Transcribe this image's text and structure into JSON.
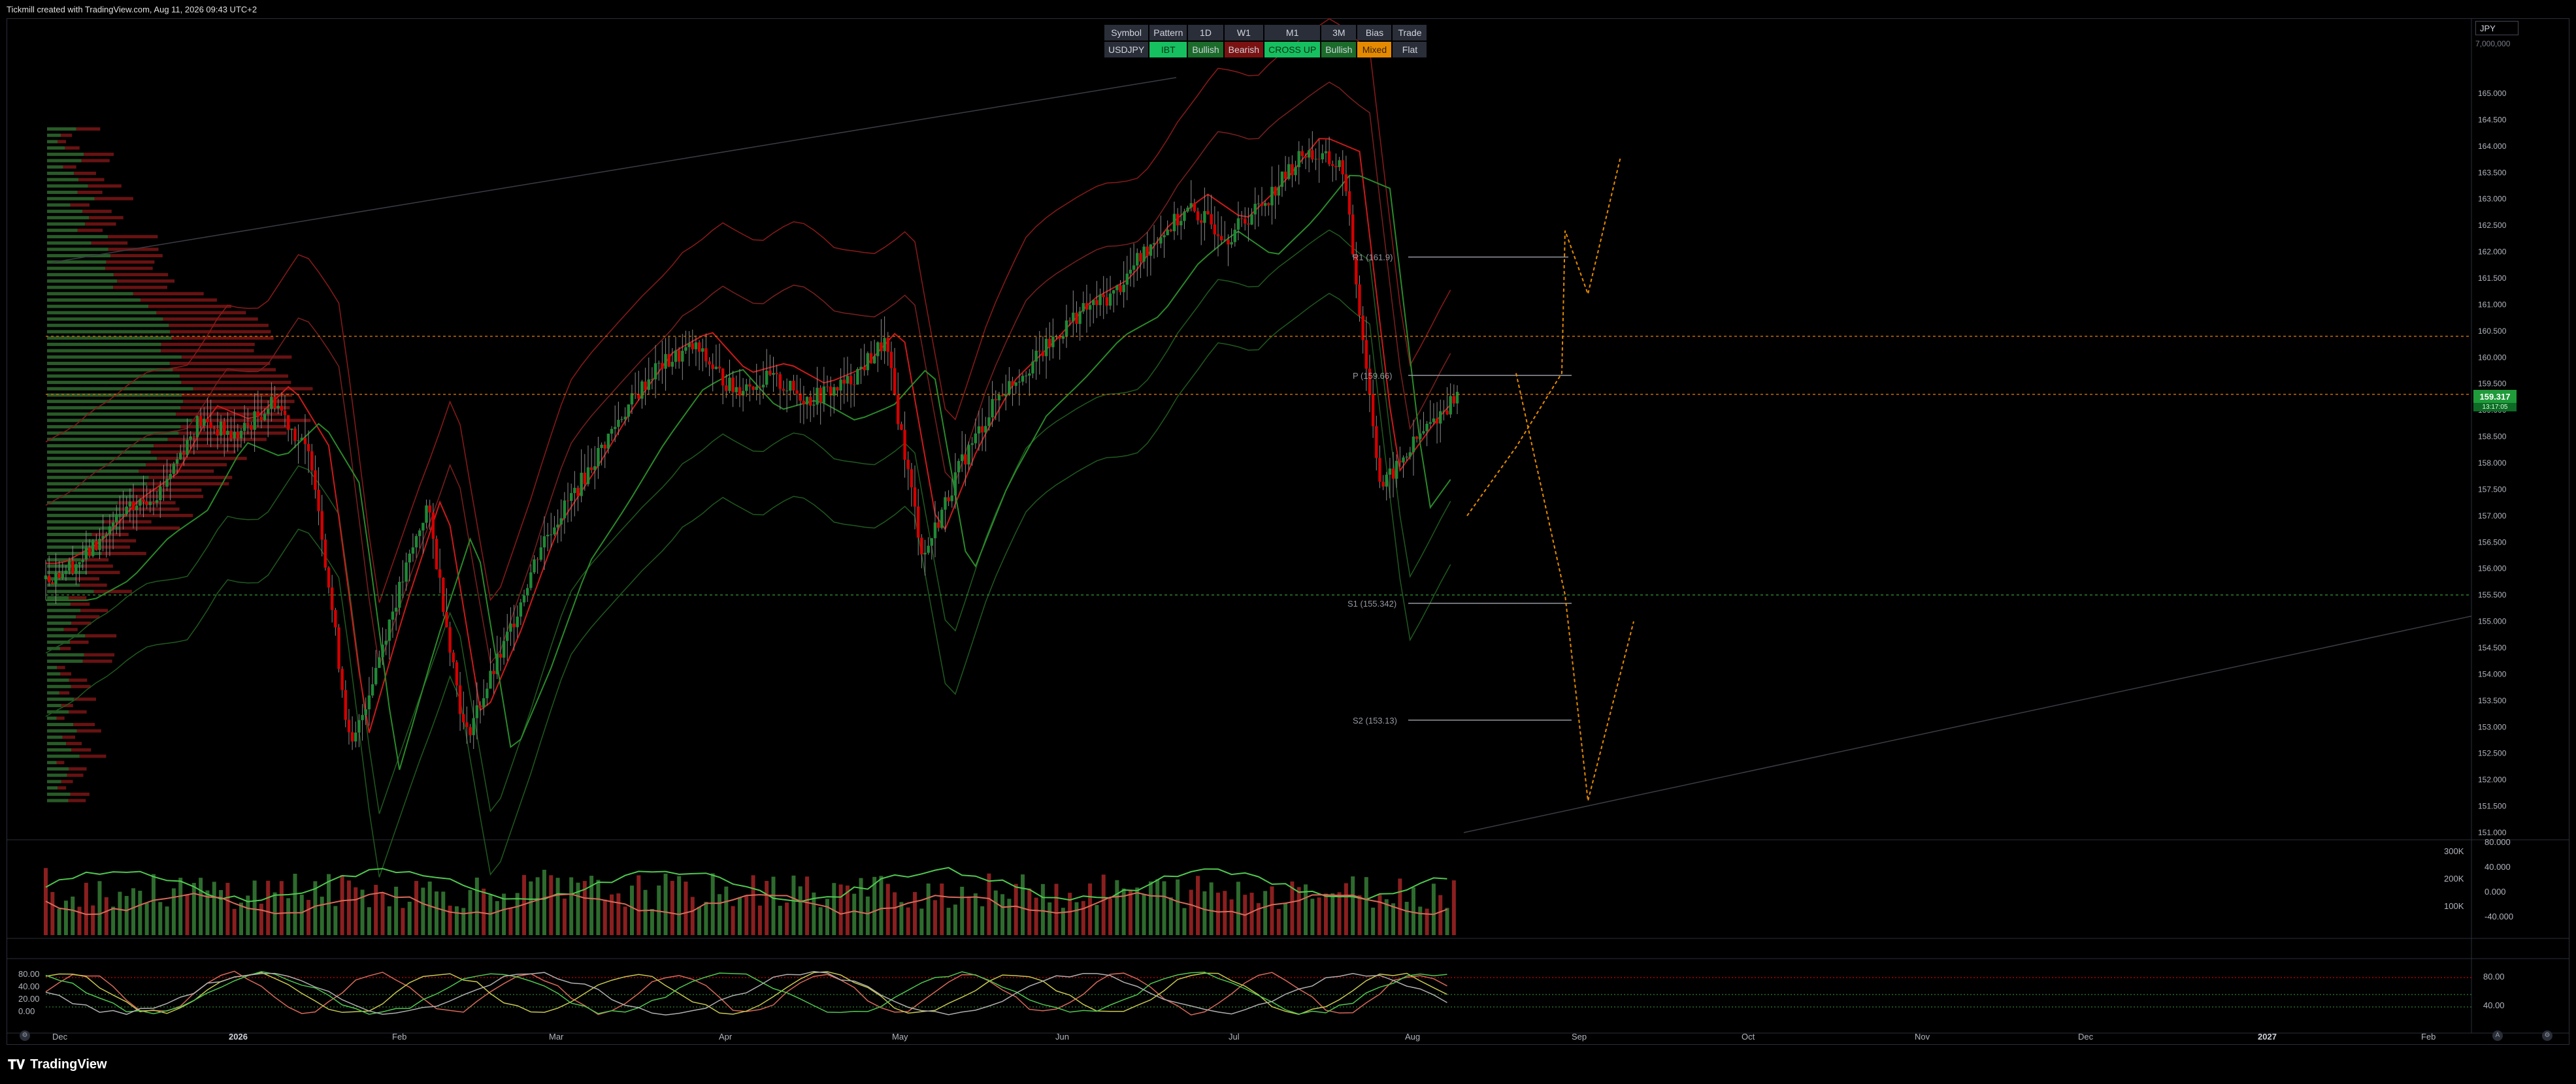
{
  "header": {
    "credit": "Tickmill created with TradingView.com, Aug 11, 2026 09:43 UTC+2"
  },
  "currency": "JPY",
  "volume_axis_top": "7,000,000",
  "last_price": "159.317",
  "last_price_sub": "13:17:05",
  "info_table": {
    "headers": [
      "Symbol",
      "Pattern",
      "1D",
      "W1",
      "M1",
      "3M",
      "Bias",
      "Trade"
    ],
    "values": [
      "USDJPY",
      "IBT",
      "Bullish",
      "Bearish",
      "CROSS UP",
      "Bullish",
      "Mixed",
      "Flat"
    ]
  },
  "price_axis": [
    "165.000",
    "164.500",
    "164.000",
    "163.500",
    "163.000",
    "162.500",
    "162.000",
    "161.500",
    "161.000",
    "160.500",
    "160.000",
    "159.500",
    "159.000",
    "158.500",
    "158.000",
    "157.500",
    "157.000",
    "156.500",
    "156.000",
    "155.500",
    "155.000",
    "154.500",
    "154.000",
    "153.500",
    "153.000",
    "152.500",
    "152.000",
    "151.500",
    "151.000"
  ],
  "volume_axis": [
    "300K",
    "200K",
    "100K"
  ],
  "osc1_axis": [
    "80.000",
    "40.000",
    "0.000",
    "-40.000"
  ],
  "osc2_axis_left": [
    "80.00",
    "40.00",
    "20.00",
    "0.00"
  ],
  "osc2_axis_right": [
    "80.00",
    "40.00"
  ],
  "time_axis": [
    {
      "label": "Dec",
      "bold": false
    },
    {
      "label": "2026",
      "bold": true
    },
    {
      "label": "Feb",
      "bold": false
    },
    {
      "label": "Mar",
      "bold": false
    },
    {
      "label": "Apr",
      "bold": false
    },
    {
      "label": "May",
      "bold": false
    },
    {
      "label": "Jun",
      "bold": false
    },
    {
      "label": "Jul",
      "bold": false
    },
    {
      "label": "Aug",
      "bold": false
    },
    {
      "label": "Sep",
      "bold": false
    },
    {
      "label": "Oct",
      "bold": false
    },
    {
      "label": "Nov",
      "bold": false
    },
    {
      "label": "Dec",
      "bold": false
    },
    {
      "label": "2027",
      "bold": true
    },
    {
      "label": "Feb",
      "bold": false
    }
  ],
  "levels": {
    "r1": "R1 (161.9)",
    "p": "P (159.66)",
    "s1": "S1 (155.342)",
    "s2": "S2 (153.13)"
  },
  "chart_data": {
    "type": "candlestick",
    "symbol": "USDJPY",
    "ylim": [
      151.0,
      165.0
    ],
    "close_path": [
      155.8,
      156.2,
      157.0,
      157.5,
      158.8,
      158.5,
      159.2,
      158.0,
      152.5,
      155.0,
      157.2,
      152.8,
      154.5,
      156.5,
      157.6,
      158.8,
      159.8,
      160.2,
      159.4,
      159.6,
      159.2,
      159.5,
      160.3,
      156.2,
      158.0,
      159.3,
      160.0,
      160.8,
      161.2,
      162.2,
      162.8,
      162.3,
      163.0,
      163.9,
      163.6,
      157.5,
      158.5,
      159.3
    ],
    "horizontal_levels": [
      160.4,
      159.3,
      155.5
    ],
    "projection_path": [
      157.0,
      158.3,
      159.7,
      162.4,
      161.2,
      163.8
    ],
    "bearish_projection": [
      159.7,
      155.5,
      151.6,
      155.0
    ],
    "oscillator_levels": [
      80,
      40,
      20,
      0
    ]
  },
  "bottom": {
    "logo": "TradingView"
  },
  "colors": {
    "bull": "#1f8a36",
    "bear": "#d40000",
    "accent": "#e58a00"
  }
}
